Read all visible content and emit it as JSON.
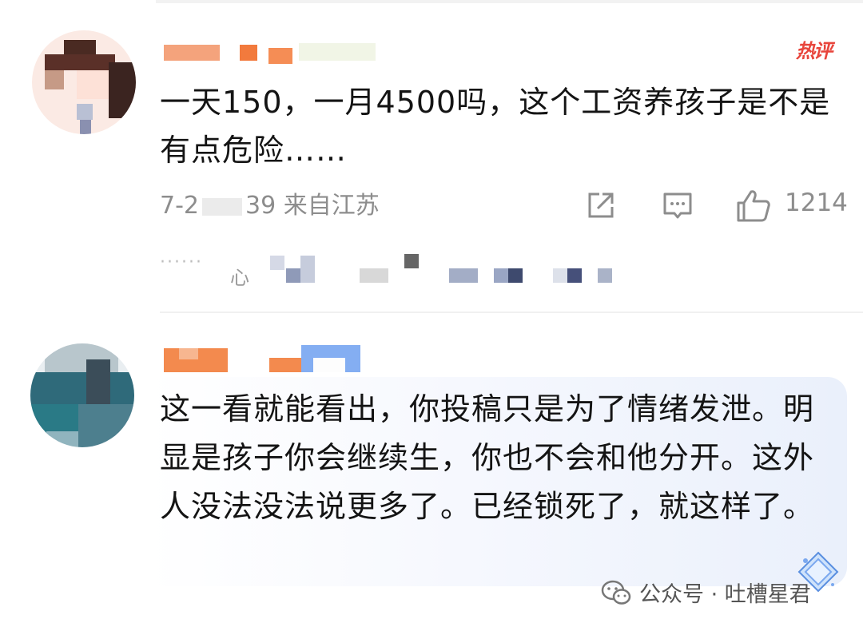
{
  "comments": [
    {
      "hot_label": "热评",
      "text": "一天150，一月4500吗，这个工资养孩子是不是有点危险……",
      "meta_date_start": "7-2",
      "meta_time_end": "39",
      "meta_location": "来自江苏",
      "like_count": "1214",
      "sub_reply_label": "心"
    },
    {
      "text": "这一看就能看出，你投稿只是为了情绪发泄。明显是孩子你会继续生，你也不会和他分开。这外人没法没法说更多了。已经锁死了，就这样了。"
    }
  ],
  "watermark": {
    "text": "公众号 · 吐槽星君"
  },
  "colors": {
    "hot": "#e8453c",
    "meta_gray": "#8d8d8d",
    "name_orange": "#f07b3a",
    "bubble_tint": "#eaf0fb"
  },
  "icons": [
    "share-icon",
    "reply-icon",
    "like-icon",
    "wechat-icon",
    "gem-icon"
  ]
}
